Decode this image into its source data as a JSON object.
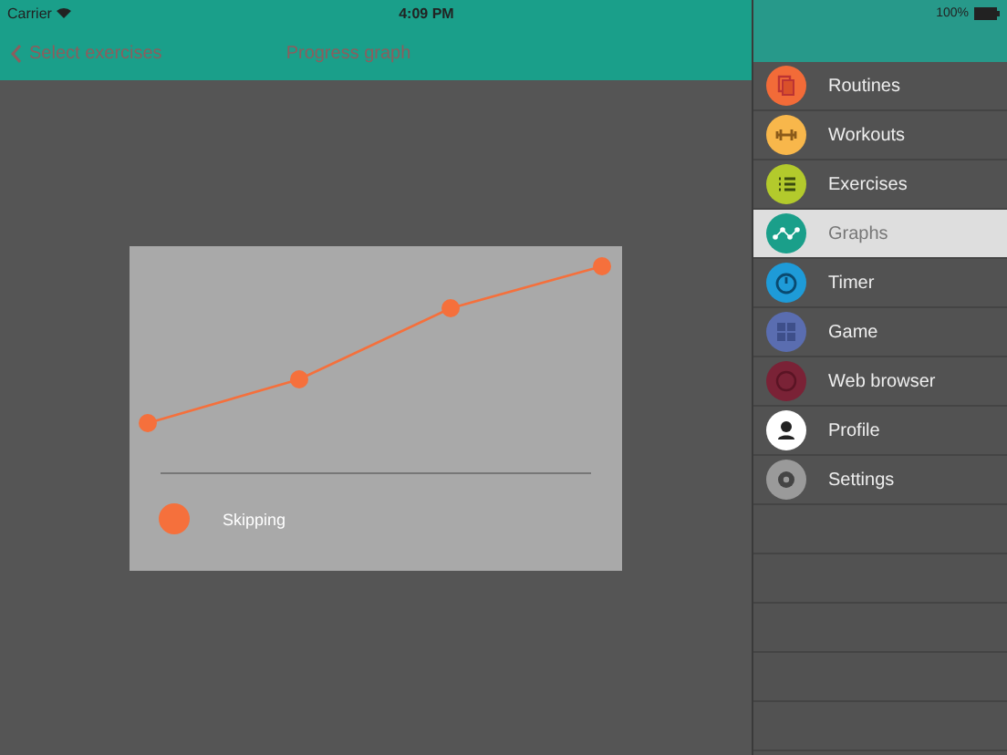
{
  "status_bar": {
    "carrier": "Carrier",
    "time": "4:09 PM",
    "battery": "100%"
  },
  "nav_bar": {
    "back": "Select exercises",
    "title": "Progress graph"
  },
  "graph": {
    "legend": [
      {
        "label": "Skipping",
        "color": "#f5703c"
      }
    ]
  },
  "menu": {
    "items": [
      {
        "label": "Routines",
        "kind": "routines",
        "color": "#f26b38",
        "selected": false
      },
      {
        "label": "Workouts",
        "kind": "workouts",
        "color": "#f8b74b",
        "selected": false
      },
      {
        "label": "Exercises",
        "kind": "exercises",
        "color": "#b3ca2c",
        "selected": false
      },
      {
        "label": "Graphs",
        "kind": "graphs",
        "color": "#1a9f8a",
        "selected": true
      },
      {
        "label": "Timer",
        "kind": "timer",
        "color": "#1e9bd8",
        "selected": false
      },
      {
        "label": "Game",
        "kind": "game",
        "color": "#5a6db0",
        "selected": false
      },
      {
        "label": "Web browser",
        "kind": "browser",
        "color": "#7a2236",
        "selected": false
      },
      {
        "label": "Profile",
        "kind": "profile",
        "color": "#ffffff",
        "selected": false
      },
      {
        "label": "Settings",
        "kind": "settings",
        "color": "#9a9a9a",
        "selected": false
      }
    ]
  }
}
